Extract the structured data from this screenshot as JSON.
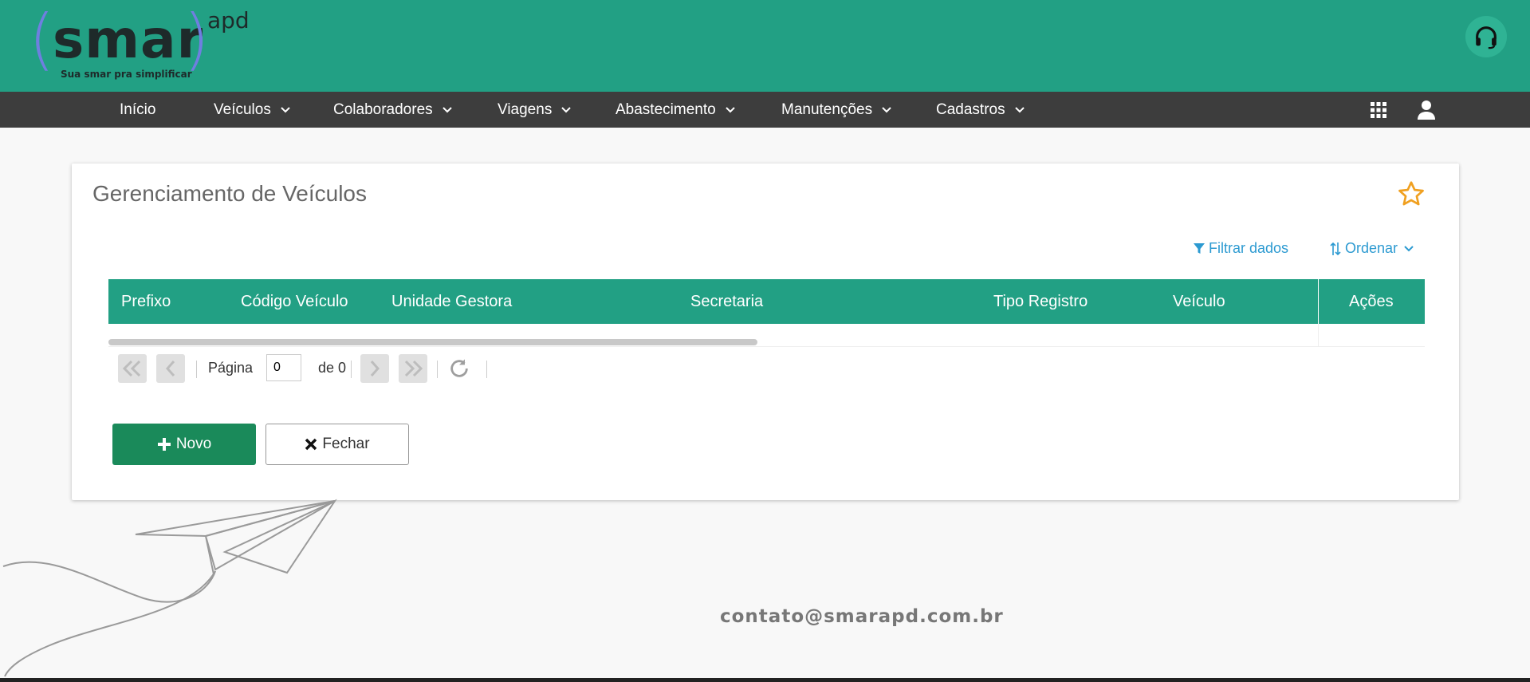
{
  "brand": {
    "open_paren": "(",
    "name": "smar",
    "close_paren": ")",
    "sup": "apd",
    "tagline": "Sua smar pra simplificar",
    "colors": {
      "primary": "#22a084",
      "nav": "#3d3d3d",
      "accent": "#6f7fe0"
    }
  },
  "header": {
    "support_icon": "headset-icon"
  },
  "nav": {
    "items": [
      {
        "label": "Início",
        "dropdown": false
      },
      {
        "label": "Veículos",
        "dropdown": true
      },
      {
        "label": "Colaboradores",
        "dropdown": true
      },
      {
        "label": "Viagens",
        "dropdown": true
      },
      {
        "label": "Abastecimento",
        "dropdown": true
      },
      {
        "label": "Manutenções",
        "dropdown": true
      },
      {
        "label": "Cadastros",
        "dropdown": true
      }
    ],
    "right_icons": [
      "apps-grid-icon",
      "user-icon"
    ]
  },
  "page": {
    "title": "Gerenciamento de Veículos",
    "favorite_icon": "star-icon",
    "filter_label": "Filtrar dados",
    "sort_label": "Ordenar"
  },
  "table": {
    "columns": [
      "Prefixo",
      "Código Veículo",
      "Unidade Gestora",
      "Secretaria",
      "Tipo Registro",
      "Veículo",
      "Ações"
    ],
    "rows": []
  },
  "pager": {
    "page_label": "Página",
    "page_value": "0",
    "of_label": "de 0"
  },
  "actions": {
    "new_label": "Novo",
    "close_label": "Fechar"
  },
  "footer": {
    "contact": "contato@smarapd.com.br"
  }
}
